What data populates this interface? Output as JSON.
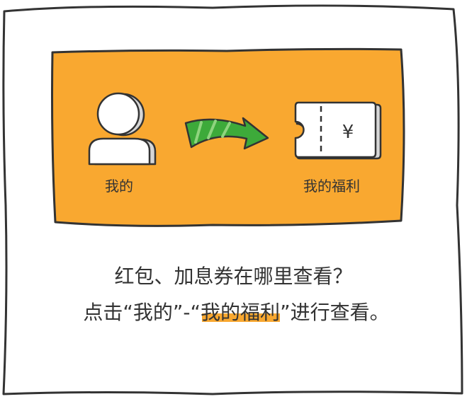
{
  "diagram": {
    "source_label": "我的",
    "target_label": "我的福利",
    "ticket_symbol": "¥",
    "caption_line1": "红包、加息券在哪里查看？",
    "caption_line2_prefix": "点击“我的”-“",
    "caption_line2_highlight": "我的福利",
    "caption_line2_suffix": "”进行查看。"
  },
  "colors": {
    "panel_orange": "#F9A830",
    "arrow_green": "#3DAA3A",
    "stroke_dark": "#333333",
    "paper_white": "#FFFFFF"
  },
  "icons": [
    "user-icon",
    "arrow-right-icon",
    "ticket-icon"
  ]
}
